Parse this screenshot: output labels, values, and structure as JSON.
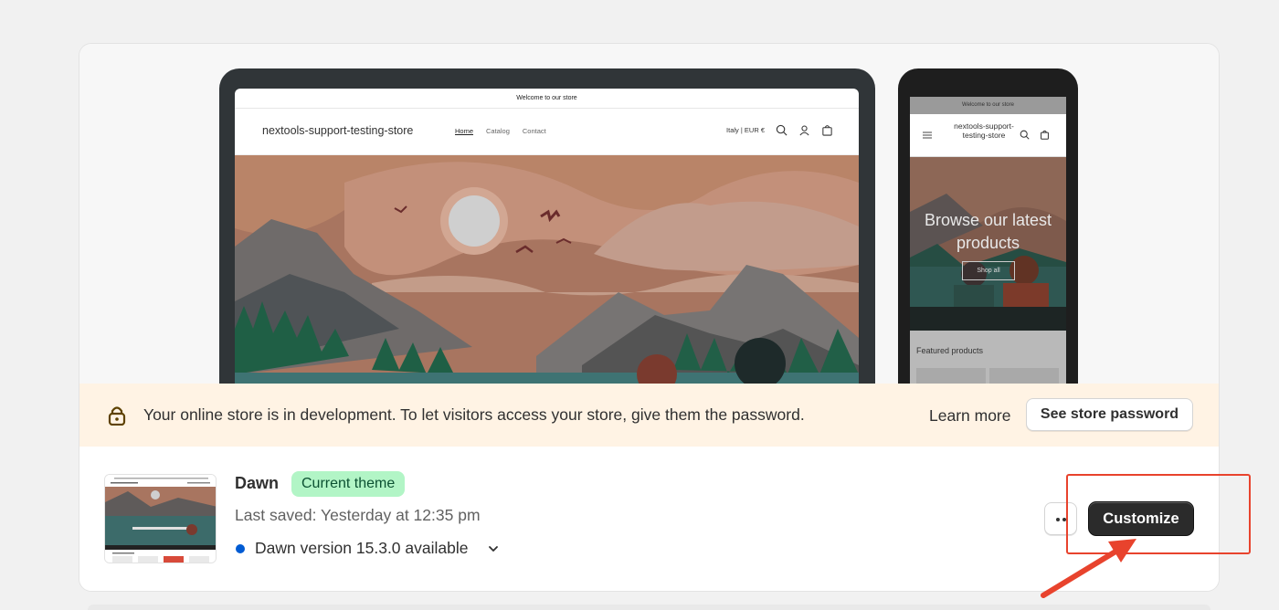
{
  "desktop_preview": {
    "announcement": "Welcome to our store",
    "store_name": "nextools-support-testing-store",
    "nav": [
      "Home",
      "Catalog",
      "Contact"
    ],
    "locale": "Italy | EUR €"
  },
  "mobile_preview": {
    "announcement": "Welcome to our store",
    "store_name": "nextools-support-testing-store",
    "hero_text": "Browse our latest products",
    "shop_all": "Shop all",
    "featured": "Featured products"
  },
  "banner": {
    "message": "Your online store is in development. To let visitors access your store, give them the password.",
    "learn_more": "Learn more",
    "see_password": "See store password"
  },
  "theme": {
    "name": "Dawn",
    "badge": "Current theme",
    "last_saved": "Last saved: Yesterday at 12:35 pm",
    "version": "Dawn version 15.3.0 available",
    "customize": "Customize"
  },
  "colors": {
    "badge_bg": "#b2f5c6",
    "banner_bg": "#fff3e4",
    "version_dot": "#005bd3",
    "annotation": "#e8432d"
  }
}
